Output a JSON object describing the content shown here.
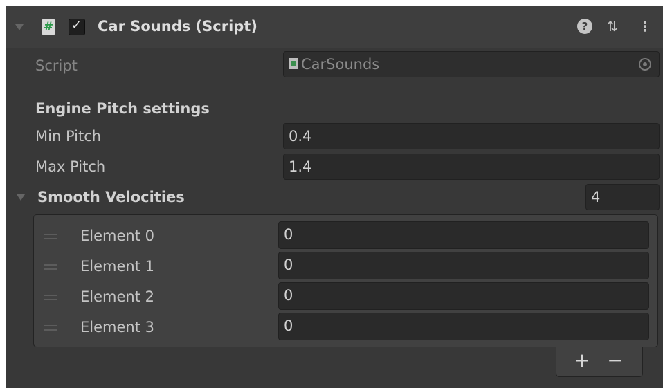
{
  "component": {
    "title": "Car Sounds (Script)",
    "enabled_check": "✓",
    "script_icon_glyph": "#",
    "help_icon_glyph": "?",
    "presets_icon_glyph": "⇅",
    "menu_icon_glyph": "⋮"
  },
  "script_field": {
    "label": "Script",
    "value": "CarSounds"
  },
  "engine_section": {
    "header": "Engine Pitch settings",
    "min_pitch": {
      "label": "Min Pitch",
      "value": "0.4"
    },
    "max_pitch": {
      "label": "Max Pitch",
      "value": "1.4"
    }
  },
  "smooth_velocities": {
    "label": "Smooth Velocities",
    "size": "4",
    "elements": [
      {
        "label": "Element 0",
        "value": "0"
      },
      {
        "label": "Element 1",
        "value": "0"
      },
      {
        "label": "Element 2",
        "value": "0"
      },
      {
        "label": "Element 3",
        "value": "0"
      }
    ],
    "add_label": "+",
    "remove_label": "−"
  },
  "colors": {
    "panel_bg": "#383838",
    "header_bg": "#3e3e3e",
    "field_bg": "#2a2a2a",
    "text": "#c4c4c4",
    "script_icon_green": "#2b9a49"
  }
}
